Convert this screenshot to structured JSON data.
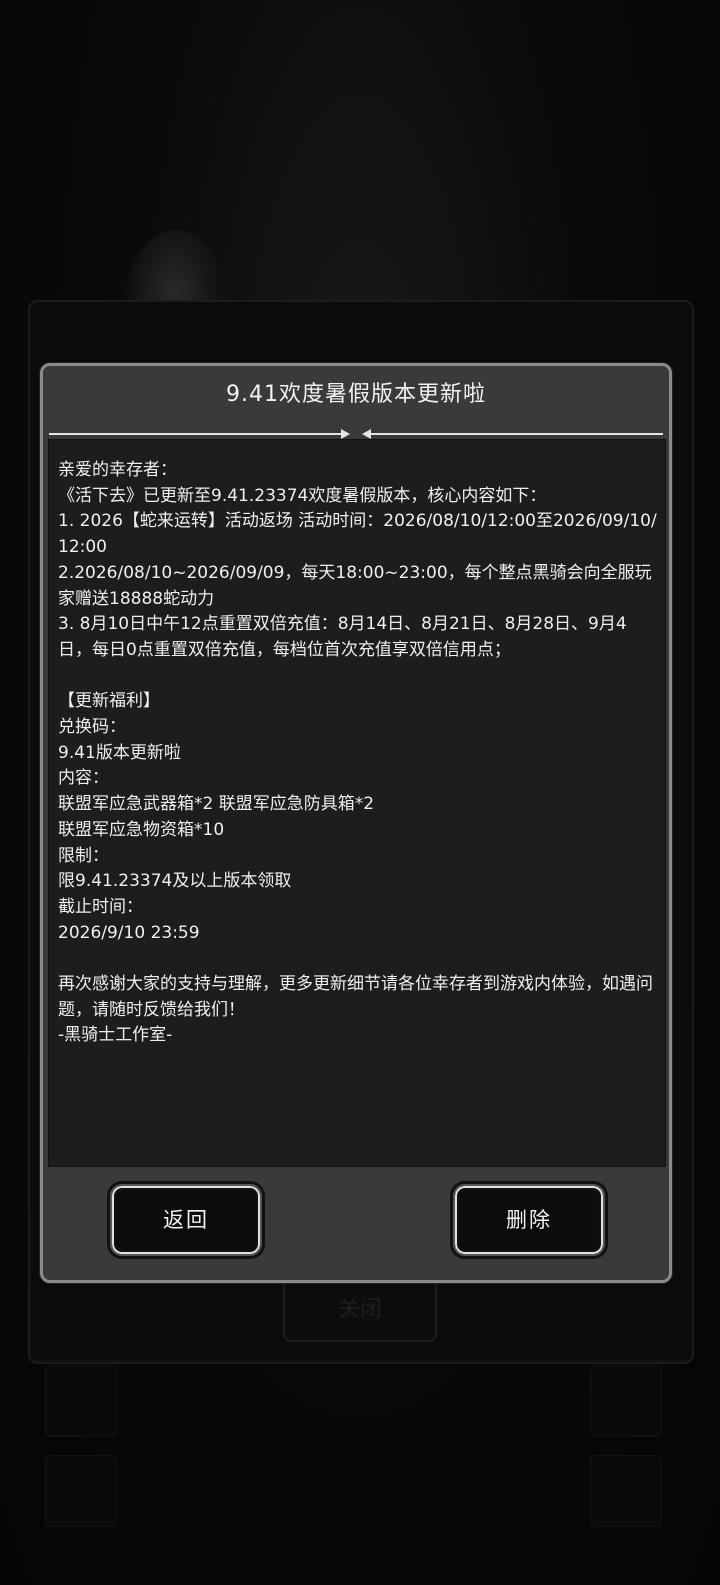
{
  "background": {
    "button_label": "关闭"
  },
  "dialog": {
    "title": "9.41欢度暑假版本更新啦",
    "body_lines": [
      "亲爱的幸存者：",
      "《活下去》已更新至9.41.23374欢度暑假版本，核心内容如下：",
      "1. 2026【蛇来运转】活动返场 活动时间：2026/08/10/12:00至2026/09/10/12:00",
      "2.2026/08/10~2026/09/09，每天18:00~23:00，每个整点黑骑会向全服玩家赠送18888蛇动力",
      "3. 8月10日中午12点重置双倍充值：8月14日、8月21日、8月28日、9月4日，每日0点重置双倍充值，每档位首次充值享双倍信用点；",
      "",
      "【更新福利】",
      "兑换码：",
      "9.41版本更新啦",
      "内容：",
      "联盟军应急武器箱*2 联盟军应急防具箱*2",
      "联盟军应急物资箱*10",
      "限制：",
      "限9.41.23374及以上版本领取",
      "截止时间：",
      "2026/9/10 23:59",
      "",
      "再次感谢大家的支持与理解，更多更新细节请各位幸存者到游戏内体验，如遇问题，请随时反馈给我们！",
      "-黑骑士工作室-"
    ],
    "back_label": "返回",
    "delete_label": "删除"
  }
}
